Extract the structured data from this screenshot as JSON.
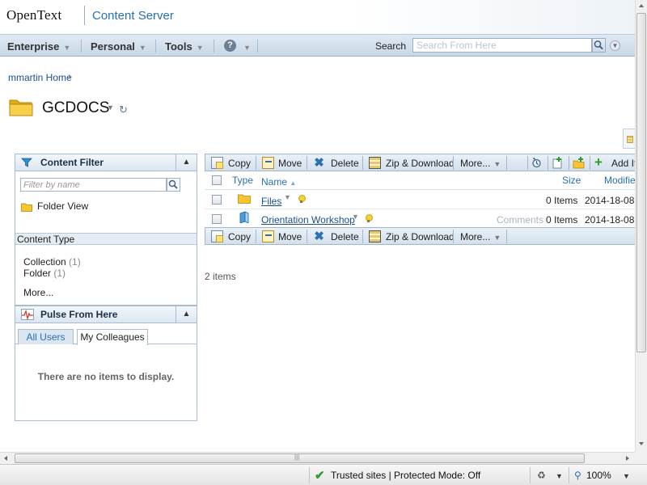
{
  "header": {
    "brand": "OpenText",
    "product": "Content Server"
  },
  "menubar": {
    "items": [
      {
        "label": "Enterprise"
      },
      {
        "label": "Personal"
      },
      {
        "label": "Tools"
      }
    ],
    "help_glyph": "?",
    "search_label": "Search",
    "search_placeholder": "Search From Here"
  },
  "breadcrumb": {
    "home": "mmartin Home"
  },
  "page": {
    "title": "GCDOCS"
  },
  "content_filter": {
    "title": "Content Filter",
    "filter_placeholder": "Filter by name",
    "folder_view": "Folder View",
    "content_type_heading": "Content Type",
    "types": [
      {
        "label": "Collection",
        "count": "(1)"
      },
      {
        "label": "Folder",
        "count": "(1)"
      }
    ],
    "more": "More..."
  },
  "pulse": {
    "title": "Pulse From Here",
    "tabs": [
      "All Users",
      "My Colleagues"
    ],
    "empty": "There are no items to display."
  },
  "toolbar": {
    "copy": "Copy",
    "move": "Move",
    "delete": "Delete",
    "zip": "Zip & Download",
    "more": "More...",
    "add_item": "Add It"
  },
  "table": {
    "columns": {
      "type": "Type",
      "name": "Name",
      "size": "Size",
      "modified": "Modifie"
    },
    "rows": [
      {
        "name": "Files",
        "comments": "",
        "size": "0 Items",
        "modified": "2014-18-08"
      },
      {
        "name": "Orientation Workshop",
        "comments": "Comments",
        "size": "0 Items",
        "modified": "2014-18-08"
      }
    ],
    "items_count": "2 items"
  },
  "statusbar": {
    "zone": "Trusted sites | Protected Mode: Off",
    "zoom": "100%"
  },
  "colors": {
    "accent": "#2a6fb5",
    "link": "#1a4f8a",
    "panel_border": "#a9bccf",
    "folder": "#f5c631"
  },
  "icons": [
    "funnel-icon",
    "pulse-icon",
    "folder-icon",
    "collection-icon",
    "copy-icon",
    "move-icon",
    "delete-icon",
    "zip-icon",
    "search-icon",
    "refresh-icon",
    "bulb-icon",
    "add-icon",
    "check-icon"
  ]
}
